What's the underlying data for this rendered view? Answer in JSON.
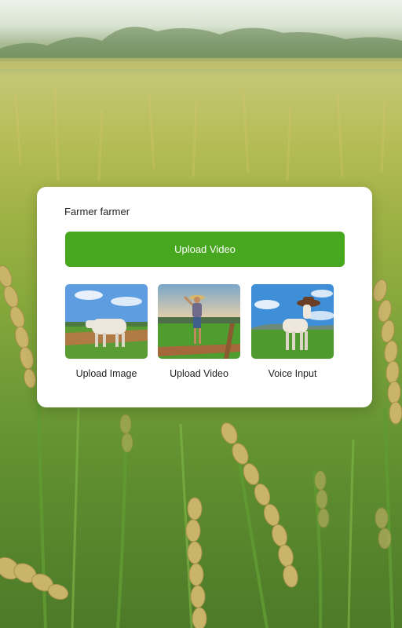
{
  "card": {
    "title": "Farmer farmer",
    "primary_button_label": "Upload Video",
    "options": [
      {
        "label": "Upload Image",
        "thumbnail": "cow-in-field"
      },
      {
        "label": "Upload Video",
        "thumbnail": "farmer-in-field"
      },
      {
        "label": "Voice Input",
        "thumbnail": "goat-with-hat"
      }
    ]
  },
  "colors": {
    "primary_button": "#47a71e",
    "card_background": "#ffffff"
  }
}
